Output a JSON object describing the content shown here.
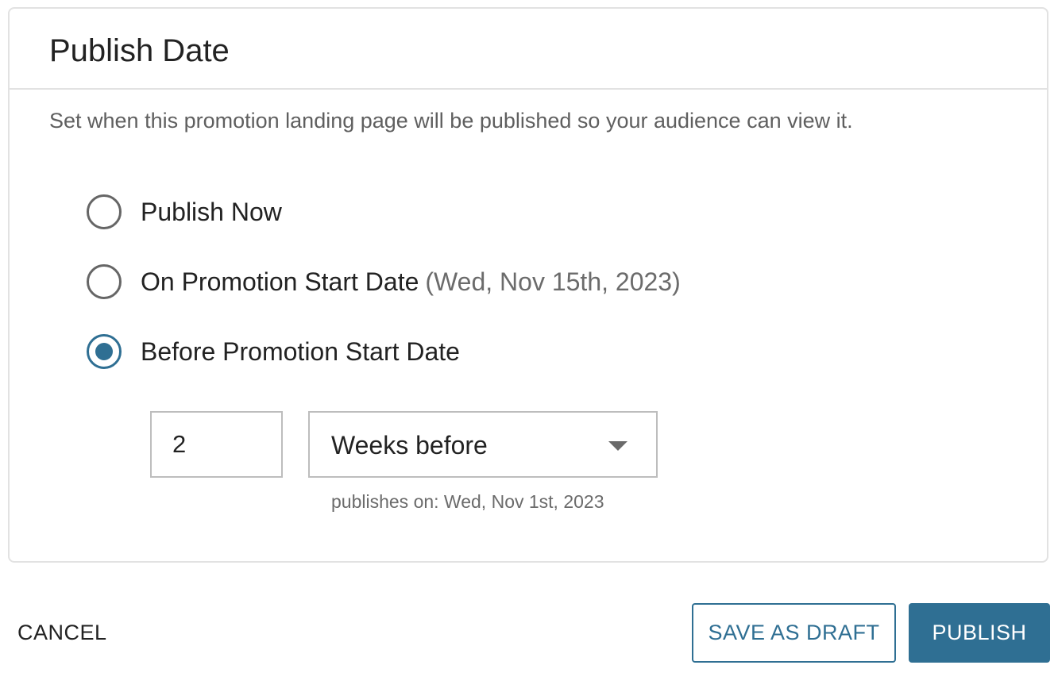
{
  "card": {
    "title": "Publish Date",
    "description": "Set when this promotion landing page will be published so your audience can view it."
  },
  "options": [
    {
      "label": "Publish Now",
      "hint": "",
      "selected": false
    },
    {
      "label": "On Promotion Start Date",
      "hint": "(Wed, Nov 15th, 2023)",
      "selected": false
    },
    {
      "label": "Before Promotion Start Date",
      "hint": "",
      "selected": true
    }
  ],
  "offset": {
    "amount": "2",
    "unit": "Weeks before",
    "publishes_on": "publishes on: Wed, Nov 1st, 2023"
  },
  "actions": {
    "cancel": "CANCEL",
    "save_draft": "SAVE AS DRAFT",
    "publish": "PUBLISH"
  },
  "colors": {
    "accent": "#2f6f93",
    "border": "#e2e2e2",
    "muted_text": "#6b6b6b"
  },
  "icons": {
    "dropdown": "chevron-down-icon"
  }
}
